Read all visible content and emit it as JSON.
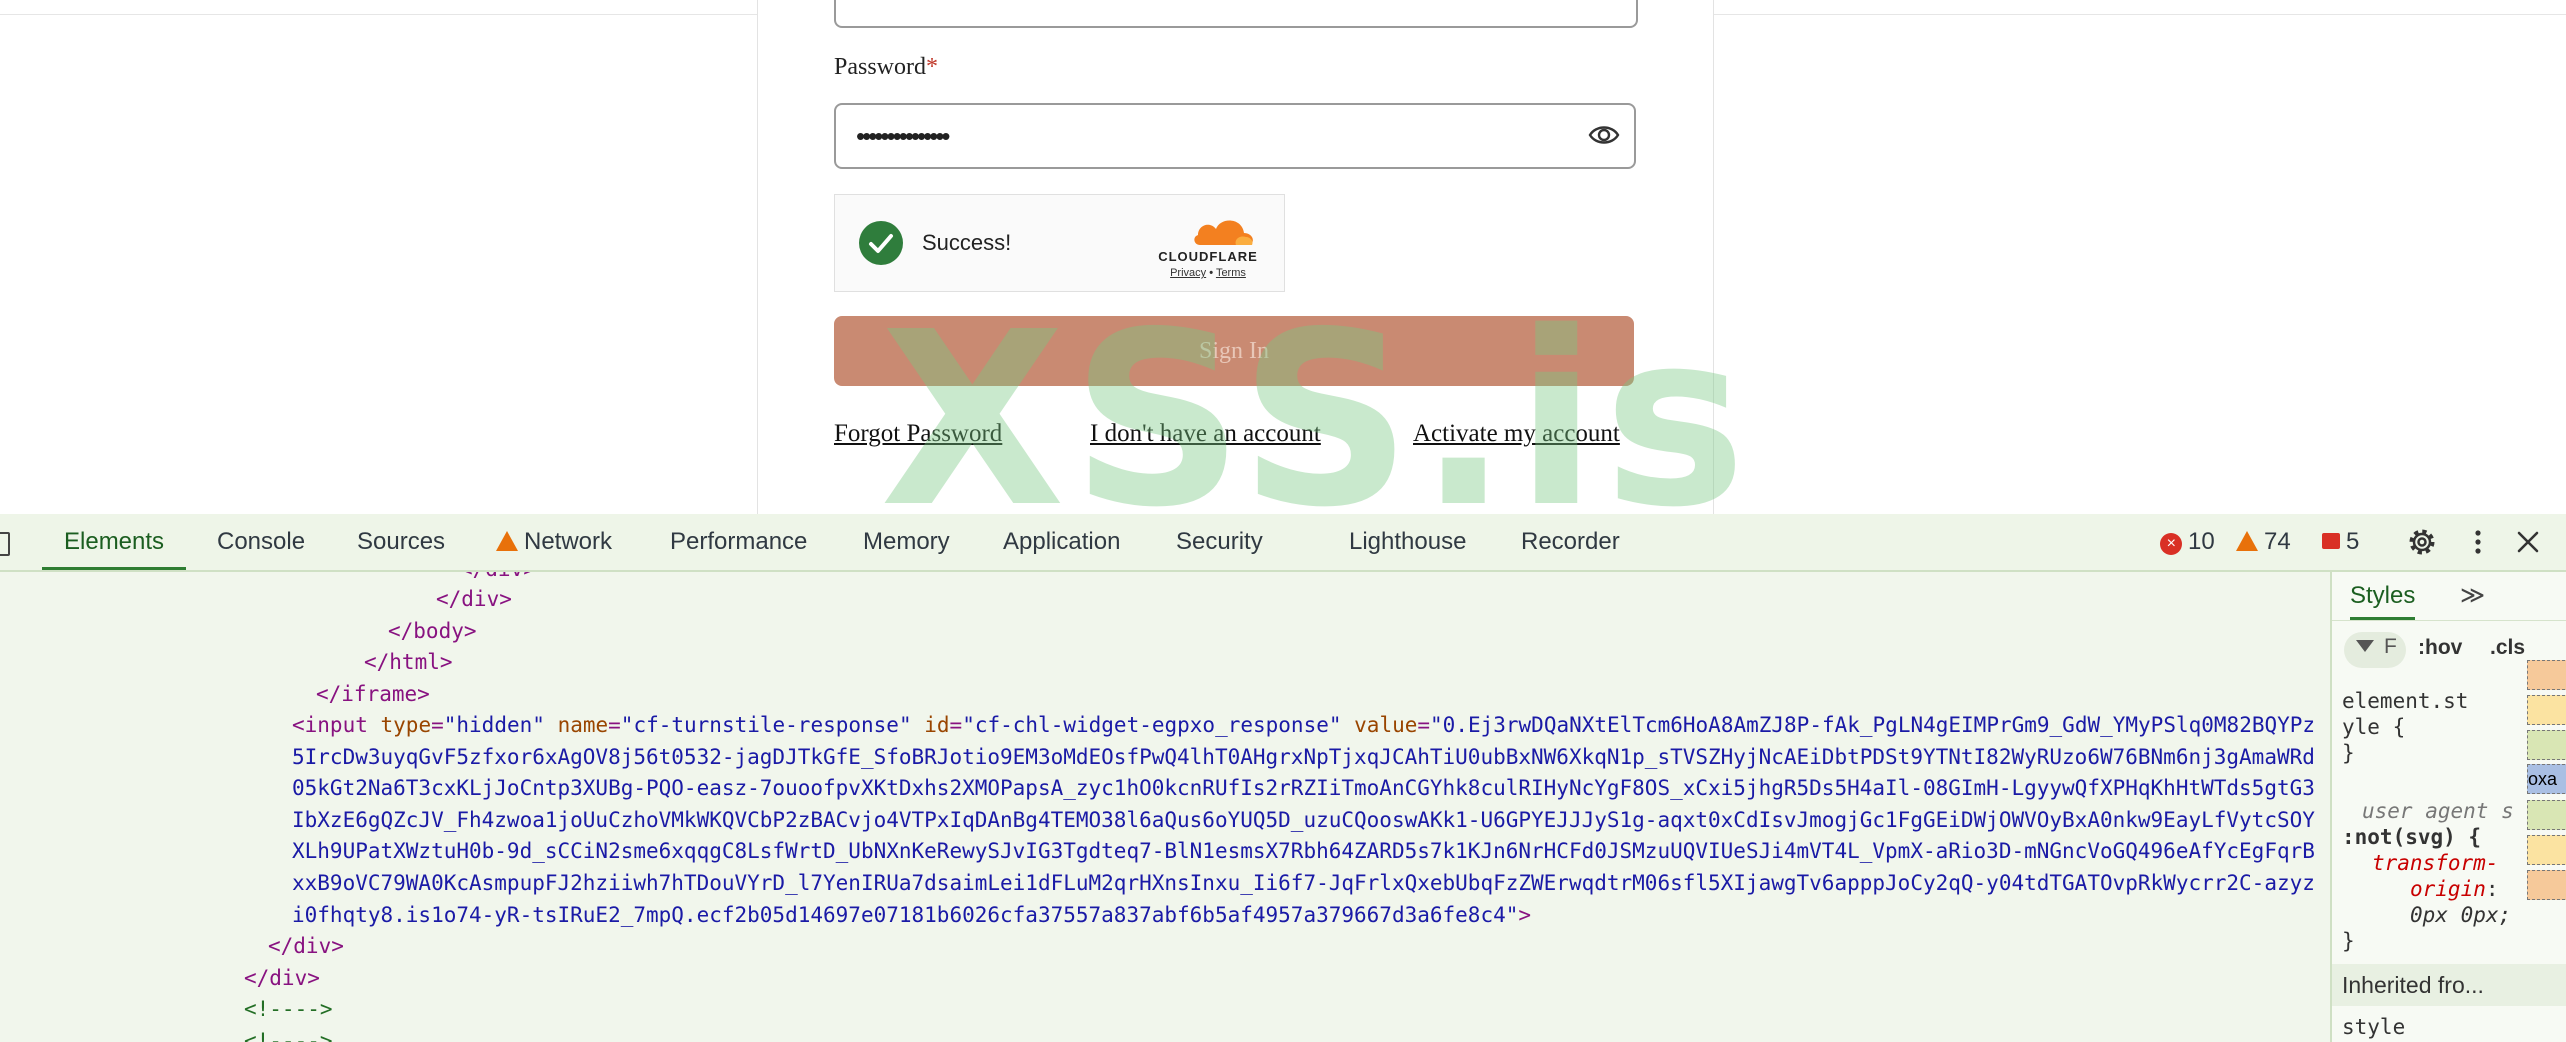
{
  "page": {
    "password_label": "Password",
    "required_mark": "*",
    "password_dots": "•••••••••••••••",
    "captcha": {
      "status": "Success!",
      "brand": "CLOUDFLARE",
      "privacy": "Privacy",
      "separator": "•",
      "terms": "Terms"
    },
    "signin_label": "Sign In",
    "links": {
      "forgot": "Forgot Password",
      "no_account": "I don't have an account",
      "activate": "Activate my account"
    },
    "watermark": "XSS.is"
  },
  "devtools": {
    "tabs": [
      "Elements",
      "Console",
      "Sources",
      "Network",
      "Performance",
      "Memory",
      "Application",
      "Security",
      "Lighthouse",
      "Recorder"
    ],
    "counters": {
      "errors": "10",
      "warnings": "74",
      "issues": "5"
    },
    "elements": {
      "l0": "</div>",
      "l1": "</div>",
      "l2": "</body>",
      "l3": "</html>",
      "l4": "</iframe>",
      "input_tag_open": "<input",
      "attr_type_name": "type",
      "attr_type_value": "\"hidden\"",
      "attr_name_name": "name",
      "attr_name_value": "\"cf-turnstile-response\"",
      "attr_id_name": "id",
      "attr_id_value": "\"cf-chl-widget-egpxo_response\"",
      "attr_value_name": "value",
      "token": "\"0.Ej3rwDQaNXtElTcm6HoA8AmZJ8P-fAk_PgLN4gEIMPrGm9_GdW_YMyPSlq0M82BQYPz5IrcDw3uyqGvF5zfxor6xAgOV8j56t0532-jagDJTkGfE_SfoBRJotio9EM3oMdEOsfPwQ4lhT0AHgrxNpTjxqJCAhTiU0ubBxNW6XkqN1p_sTVSZHyjNcAEiDbtPDSt9YTNtI82WyRUzo6W76BNm6nj3gAmaWRd05kGt2Na6T3cxKLjJoCntp3XUBg-PQO-easz-7ouoofpvXKtDxhs2XMOPapsA_zyc1hO0kcnRUfIs2rRZIiTmoAnCGYhk8culRIHyNcYgF8OS_xCxi5jhgR5Ds5H4aIl-08GImH-LgyywQfXPHqKhHtWTds5gtG3IbXzE6gQZcJV_Fh4zwoa1joUuCzhoVMkWKQVCbP2zBACvjo4VTPxIqDAnBg4TEMO38l6aQus6oYUQ5D_uzuCQooswAKk1-U6GPYEJJJyS1g-aqxt0xCdIsvJmogjGc1FgGEiDWjOWVOyBxA0nkw9EayLfVytcSOYXLh9UPatXWztuH0b-9d_sCCiN2sme6xqqgC8LsfWrtD_UbNXnKeRewySJvIG3Tgdteq7-BlN1esmsX7Rbh64ZARD5s7k1KJn6NrHCFd0JSMzuUQVIUeSJi4mVT4L_VpmX-aRio3D-mNGncVoGQ496eAfYcEgFqrBxxB9oVC79WA0KcAsmpupFJ2hziiwh7hTDouVYrD_l7YenIRUa7dsaimLei1dFLuM2qrHXnsInxu_Ii6f7-JqFrlxQxebUbqFzZWErwqdtrM06sfl5XIjawgTv6apppJoCy2qQ-y04tdTGATOvpRkWycrr2C-azyzi0fhqty8.is1o74-yR-tsIRuE2_7mpQ.ecf2b05d14697e07181b6026cfa37557a837abf6b5af4957a379667d3a6fe8c4\"",
      "input_tag_close": ">",
      "l11": "</div>",
      "l12": "</div>",
      "l13": "<!---->",
      "l14": "<!---->"
    },
    "styles": {
      "tab": "Styles",
      "more": "≫",
      "filter_placeholder": "F",
      "hov": ":hov",
      "cls": ".cls",
      "element_style_1": "element.st",
      "element_style_2": "yle {",
      "element_style_close": "}",
      "ua_label": "user agent s",
      "ua_selector": ":not(svg) {",
      "ua_prop_1": "transform-",
      "ua_prop_2": "origin",
      "ua_value": "0px 0px;",
      "ua_close": "}",
      "inherited": "Inherited fro...",
      "style_label": "style",
      "box_fragment": "oxa"
    }
  }
}
